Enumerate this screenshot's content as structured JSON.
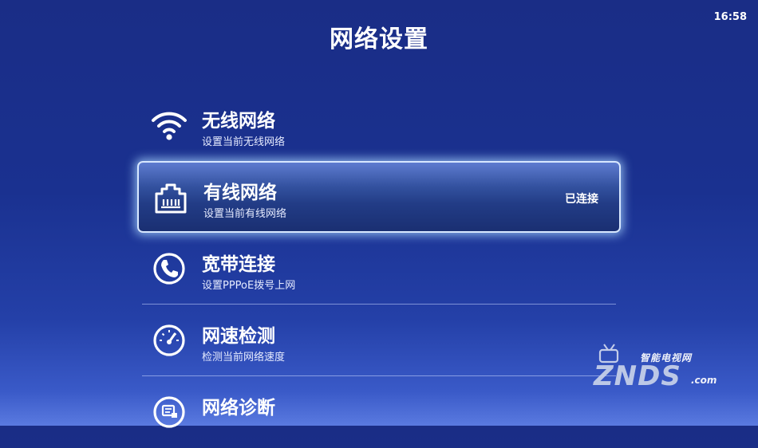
{
  "status_bar": {
    "time": "16:58"
  },
  "header": {
    "title": "网络设置"
  },
  "menu": {
    "items": [
      {
        "title": "无线网络",
        "subtitle": "设置当前无线网络",
        "status": "",
        "icon": "wifi-icon"
      },
      {
        "title": "有线网络",
        "subtitle": "设置当前有线网络",
        "status": "已连接",
        "icon": "ethernet-icon"
      },
      {
        "title": "宽带连接",
        "subtitle": "设置PPPoE拨号上网",
        "status": "",
        "icon": "phone-icon"
      },
      {
        "title": "网速检测",
        "subtitle": "检测当前网络速度",
        "status": "",
        "icon": "speedometer-icon"
      },
      {
        "title": "网络诊断",
        "subtitle": "",
        "status": "",
        "icon": "diagnose-icon"
      }
    ],
    "selected_index": 1
  },
  "watermark": {
    "top_text": "智能电视网",
    "main_text": "ZNDS",
    "suffix": ".com"
  },
  "colors": {
    "background_top": "#1a2d86",
    "background_bottom": "#5a7ae0",
    "selection_glow": "#aad7ff"
  }
}
